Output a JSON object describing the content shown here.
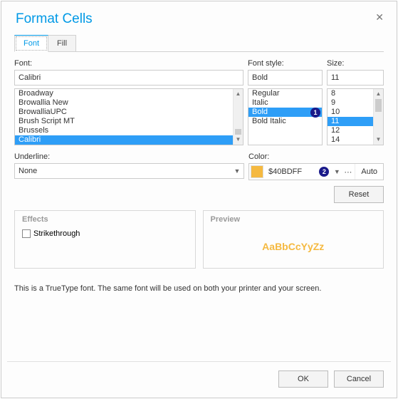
{
  "title": "Format Cells",
  "tabs": {
    "font": "Font",
    "fill": "Fill"
  },
  "font_section": {
    "label": "Font:",
    "value": "Calibri",
    "items": [
      "Broadway",
      "Browallia New",
      "BrowalliaUPC",
      "Brush Script MT",
      "Brussels",
      "Calibri"
    ]
  },
  "style_section": {
    "label": "Font style:",
    "value": "Bold",
    "items": [
      "Regular",
      "Italic",
      "Bold",
      "Bold Italic"
    ]
  },
  "size_section": {
    "label": "Size:",
    "value": "11",
    "items": [
      "8",
      "9",
      "10",
      "11",
      "12",
      "14"
    ]
  },
  "underline": {
    "label": "Underline:",
    "value": "None"
  },
  "color": {
    "label": "Color:",
    "value": "$40BDFF",
    "auto": "Auto"
  },
  "reset": "Reset",
  "effects": {
    "title": "Effects",
    "strikethrough": "Strikethrough"
  },
  "preview": {
    "title": "Preview",
    "sample": "AaBbCcYyZz"
  },
  "footnote": "This is a TrueType font. The same font will be used on both your printer and your screen.",
  "buttons": {
    "ok": "OK",
    "cancel": "Cancel"
  },
  "annotations": {
    "a1": "1",
    "a2": "2"
  }
}
